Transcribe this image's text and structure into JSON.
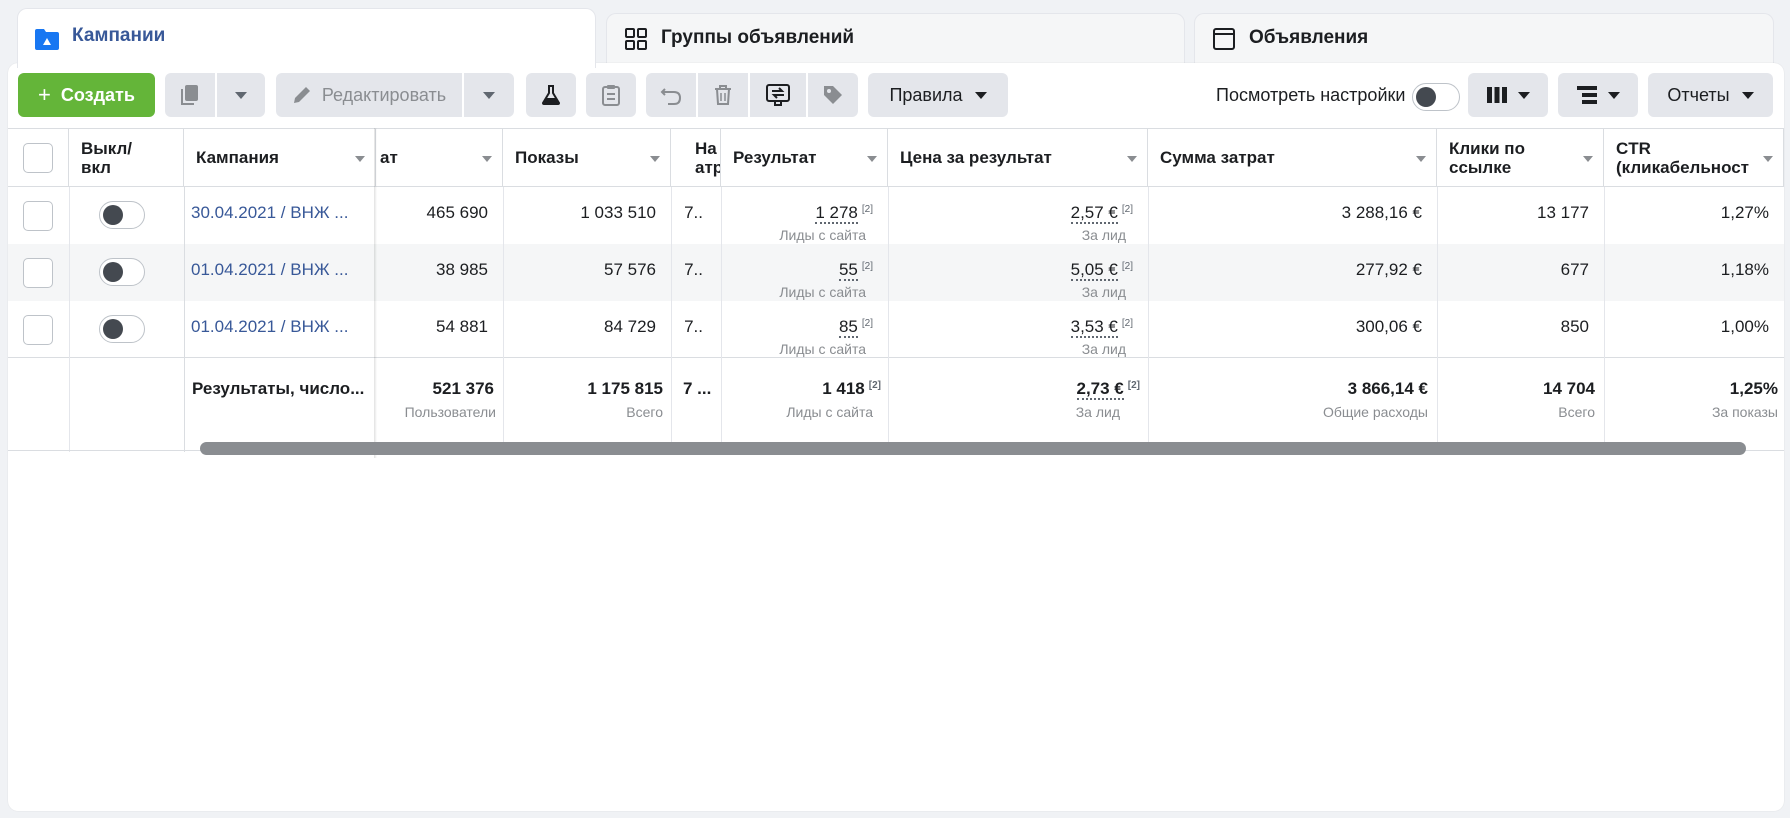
{
  "tabs": [
    {
      "label": "Кампании"
    },
    {
      "label": "Группы объявлений"
    },
    {
      "label": "Объявления"
    }
  ],
  "toolbar": {
    "create_label": "Создать",
    "edit_label": "Редактировать",
    "rules_label": "Правила",
    "view_settings_label": "Посмотреть настройки",
    "reports_label": "Отчеты"
  },
  "table": {
    "headers": {
      "onoff": "Выкл/ вкл",
      "campaign": "Кампания",
      "reach_partial": "ат",
      "impressions": "Показы",
      "attr_partial": "На атр",
      "result": "Результат",
      "cost_per_result": "Цена за результат",
      "amount_spent": "Сумма затрат",
      "link_clicks": "Клики по ссылке",
      "ctr": "CTR (кликабельност"
    },
    "rows": [
      {
        "campaign": "30.04.2021 / ВНЖ ...",
        "reach": "465 690",
        "impressions": "1 033 510",
        "attr": "7..",
        "result": "1 278",
        "result_sup": "[2]",
        "result_sub": "Лиды с сайта",
        "cpr": "2,57 €",
        "cpr_sup": "[2]",
        "cpr_sub": "За лид",
        "spent": "3 288,16 €",
        "clicks": "13 177",
        "ctr": "1,27%"
      },
      {
        "campaign": "01.04.2021 / ВНЖ ...",
        "reach": "38 985",
        "impressions": "57 576",
        "attr": "7..",
        "result": "55",
        "result_sup": "[2]",
        "result_sub": "Лиды с сайта",
        "cpr": "5,05 €",
        "cpr_sup": "[2]",
        "cpr_sub": "За лид",
        "spent": "277,92 €",
        "clicks": "677",
        "ctr": "1,18%"
      },
      {
        "campaign": "01.04.2021 / ВНЖ ...",
        "reach": "54 881",
        "impressions": "84 729",
        "attr": "7..",
        "result": "85",
        "result_sup": "[2]",
        "result_sub": "Лиды с сайта",
        "cpr": "3,53 €",
        "cpr_sup": "[2]",
        "cpr_sub": "За лид",
        "spent": "300,06 €",
        "clicks": "850",
        "ctr": "1,00%"
      }
    ],
    "total": {
      "label": "Результаты, число...",
      "reach": "521 376",
      "reach_sub": "Пользователи",
      "impressions": "1 175 815",
      "impressions_sub": "Всего",
      "attr": "7 ...",
      "result": "1 418",
      "result_sup": "[2]",
      "result_sub": "Лиды с сайта",
      "cpr": "2,73 €",
      "cpr_sup": "[2]",
      "cpr_sub": "За лид",
      "spent": "3 866,14 €",
      "spent_sub": "Общие расходы",
      "clicks": "14 704",
      "clicks_sub": "Всего",
      "ctr": "1,25%",
      "ctr_sub": "За показы"
    }
  },
  "colors": {
    "accent": "#385898",
    "create": "#64b539",
    "link": "#385898"
  }
}
